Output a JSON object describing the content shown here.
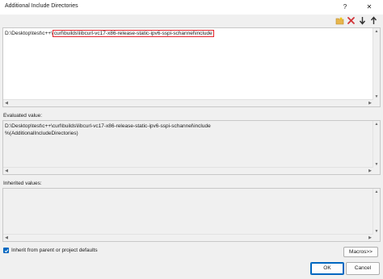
{
  "window": {
    "title": "Additional Include Directories",
    "help_label": "?",
    "close_label": "✕"
  },
  "toolbar": {
    "new_line_icon": "new-line-folder-icon",
    "delete_icon": "delete-x-icon",
    "move_down_icon": "arrow-down-icon",
    "move_up_icon": "arrow-up-icon",
    "delete_color": "#d13438"
  },
  "editor": {
    "prefix": "D:\\Desktop\\test\\c++\\",
    "highlighted": "curl\\builds\\libcurl-vc17-x86-release-static-ipv6-sspi-schannel\\include",
    "highlight_color": "#e3242b"
  },
  "evaluated": {
    "label": "Evaluated value:",
    "lines": [
      "D:\\Desktop\\test\\c++\\curl\\builds\\libcurl-vc17-x86-release-static-ipv6-sspi-schannel\\include",
      "%(AdditionalIncludeDirectories)"
    ]
  },
  "inherited": {
    "label": "Inherited values:"
  },
  "options": {
    "inherit_checked": true,
    "inherit_label": "Inherit from parent or project defaults",
    "macros_label": "Macros>>"
  },
  "footer": {
    "ok_label": "OK",
    "cancel_label": "Cancel"
  }
}
